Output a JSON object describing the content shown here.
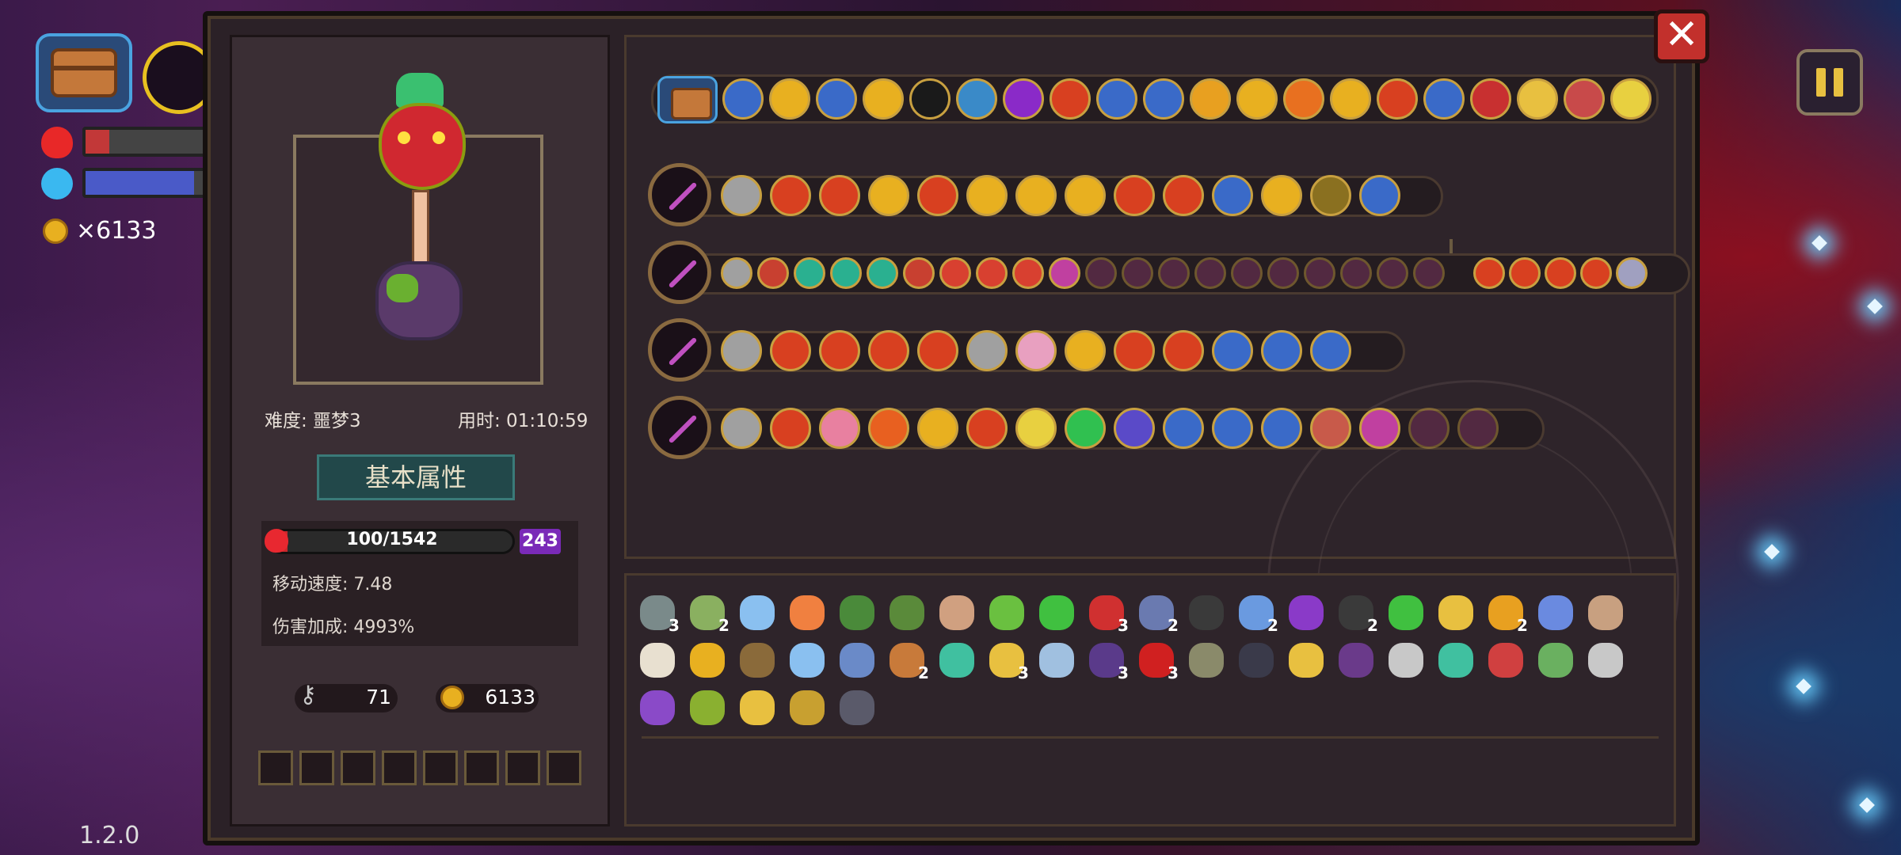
{
  "hud": {
    "gold": "×6133",
    "hp_fraction": 0.2,
    "mana_fraction": 0.9,
    "version": "1.2.0"
  },
  "run_info": {
    "difficulty": "难度: 噩梦3",
    "time": "用时: 01:10:59"
  },
  "attributes": {
    "title": "基本属性",
    "hp_text": "100/1542",
    "hp_fraction": 0.065,
    "shield": "243",
    "move_speed": "移动速度: 7.48",
    "damage_bonus": "伤害加成: 4993%",
    "keys": "71",
    "coins": "6133"
  },
  "colors": {
    "accent_gold": "#c8a040",
    "close_red": "#c2302c",
    "shield_purple": "#7a2ab8"
  },
  "passive_row": [
    "#3a6ac8",
    "#e8b020",
    "#3a6ac8",
    "#e8b020",
    "#1a1a1a",
    "#3a8ac8",
    "#8a2ac8",
    "#d84020",
    "#3a6ac8",
    "#3a6ac8",
    "#e8a020",
    "#e8b020",
    "#e87020",
    "#e8b020",
    "#d84020",
    "#3a6ac8",
    "#c83030",
    "#e8c040",
    "#c84a4a",
    "#e8d040"
  ],
  "weapon_rows": [
    {
      "icons": [
        "#a0a0a0",
        "#d84020",
        "#d84020",
        "#e8b020",
        "#d84020",
        "#e8b020",
        "#e8b020",
        "#e8b020",
        "#d84020",
        "#d84020",
        "#3a6ac8",
        "#e8b020",
        "#8a7020",
        "#3a6ac8"
      ]
    },
    {
      "icons": [
        "#a0a0a0",
        "#c84030",
        "#2ab090",
        "#2ab090",
        "#2ab090",
        "#c84030",
        "#d84030",
        "#d84030",
        "#d84030",
        "#c040a0",
        "#8a3a6a",
        "#8a3a6a",
        "#8a3a6a",
        "#8a3a6a",
        "#8a3a6a",
        "#8a3a6a",
        "#8a3a6a",
        "#8a3a6a",
        "#8a3a6a",
        "#8a3a6a"
      ],
      "extra": [
        "#d84020",
        "#d84020",
        "#d84020",
        "#d84020",
        "#a0a0c0"
      ]
    },
    {
      "icons": [
        "#a0a0a0",
        "#d84020",
        "#d84020",
        "#d84020",
        "#d84020",
        "#a0a0a0",
        "#e8a0c0",
        "#e8b020",
        "#d84020",
        "#d84020",
        "#3a6ac8",
        "#3a6ac8",
        "#3a6ac8"
      ]
    },
    {
      "icons": [
        "#a0a0a0",
        "#d84020",
        "#e880a0",
        "#e86020",
        "#e8b020",
        "#d84020",
        "#e8d040",
        "#30c050",
        "#5a4ac8",
        "#3a6ac8",
        "#3a6ac8",
        "#3a6ac8",
        "#c85a4a",
        "#c040a0",
        "#8a3a6a",
        "#8a3a6a"
      ]
    }
  ],
  "items": [
    {
      "color": "#7a8a8a",
      "count": "3"
    },
    {
      "color": "#8ab060",
      "count": "2"
    },
    {
      "color": "#8ac0f0",
      "count": ""
    },
    {
      "color": "#f08040",
      "count": ""
    },
    {
      "color": "#4a8a3a",
      "count": ""
    },
    {
      "color": "#5a8a3a",
      "count": ""
    },
    {
      "color": "#d0a080",
      "count": ""
    },
    {
      "color": "#6ac040",
      "count": ""
    },
    {
      "color": "#40c040",
      "count": ""
    },
    {
      "color": "#d03030",
      "count": "3"
    },
    {
      "color": "#6a7ab0",
      "count": "2"
    },
    {
      "color": "#3a3a3a",
      "count": ""
    },
    {
      "color": "#6a9ae0",
      "count": "2"
    },
    {
      "color": "#8a3ac8",
      "count": ""
    },
    {
      "color": "#3a3a3a",
      "count": "2"
    },
    {
      "color": "#40c040",
      "count": ""
    },
    {
      "color": "#e8c040",
      "count": ""
    },
    {
      "color": "#e8a020",
      "count": "2"
    },
    {
      "color": "#6a8ae0",
      "count": ""
    },
    {
      "color": "#c8a080",
      "count": ""
    },
    {
      "color": "#e8e0d0",
      "count": ""
    },
    {
      "color": "#e8b020",
      "count": ""
    },
    {
      "color": "#8a6a3a",
      "count": ""
    },
    {
      "color": "#8ac0f0",
      "count": ""
    },
    {
      "color": "#6a8ac8",
      "count": ""
    },
    {
      "color": "#c87a3a",
      "count": "2"
    },
    {
      "color": "#40c0a0",
      "count": ""
    },
    {
      "color": "#e8c040",
      "count": "3"
    },
    {
      "color": "#a0c0e0",
      "count": ""
    },
    {
      "color": "#5a3a8a",
      "count": "3"
    },
    {
      "color": "#d02020",
      "count": "3"
    },
    {
      "color": "#8a8a6a",
      "count": ""
    },
    {
      "color": "#3a3a4a",
      "count": ""
    },
    {
      "color": "#e8c040",
      "count": ""
    },
    {
      "color": "#6a3a8a",
      "count": ""
    },
    {
      "color": "#c8c8c8",
      "count": ""
    },
    {
      "color": "#40c0a0",
      "count": ""
    },
    {
      "color": "#d04040",
      "count": ""
    },
    {
      "color": "#6ab060",
      "count": ""
    },
    {
      "color": "#c8c8c8",
      "count": ""
    },
    {
      "color": "#8a4ac8",
      "count": ""
    },
    {
      "color": "#8ab030",
      "count": ""
    },
    {
      "color": "#e8c040",
      "count": ""
    },
    {
      "color": "#c8a030",
      "count": ""
    },
    {
      "color": "#5a5a6a",
      "count": ""
    }
  ]
}
